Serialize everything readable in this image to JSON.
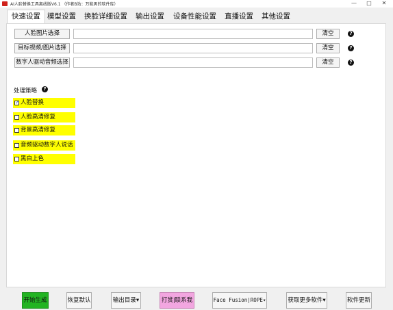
{
  "window": {
    "title": "AI人脸替换工具离线版V6.1 （作者B站：万能男的软件库）",
    "minimize": "—",
    "maximize": "□",
    "close": "✕"
  },
  "tabs": [
    "快速设置",
    "模型设置",
    "换脸详细设置",
    "输出设置",
    "设备性能设置",
    "直播设置",
    "其他设置"
  ],
  "inputs": [
    {
      "label": "人脸图片选择",
      "value": "",
      "clear": "清空"
    },
    {
      "label": "目标视频/图片选择",
      "value": "",
      "clear": "清空"
    },
    {
      "label": "数字人驱动音频选择",
      "value": "",
      "clear": "清空"
    }
  ],
  "help_icon": "?",
  "strategy": {
    "title": "处理策略",
    "options": [
      {
        "label": "人脸替换",
        "checked": true
      },
      {
        "label": "人脸高清修复",
        "checked": false
      },
      {
        "label": "背景高清修复",
        "checked": false
      },
      {
        "label": "音频驱动数字人说话",
        "checked": false
      },
      {
        "label": "黑白上色",
        "checked": false
      }
    ]
  },
  "bottom": {
    "start": "开始生成",
    "restore": "恢复默认",
    "output_dir": "输出目录",
    "donate": "打赏|联系我",
    "engine": "Face Fusion|ROPE",
    "more": "获取更多软件",
    "update": "软件更新"
  },
  "colors": {
    "start_bg": "#22b422",
    "donate_bg": "#f2a6e0",
    "option_bg": "#ffff00",
    "app_icon": "#d0211a"
  }
}
